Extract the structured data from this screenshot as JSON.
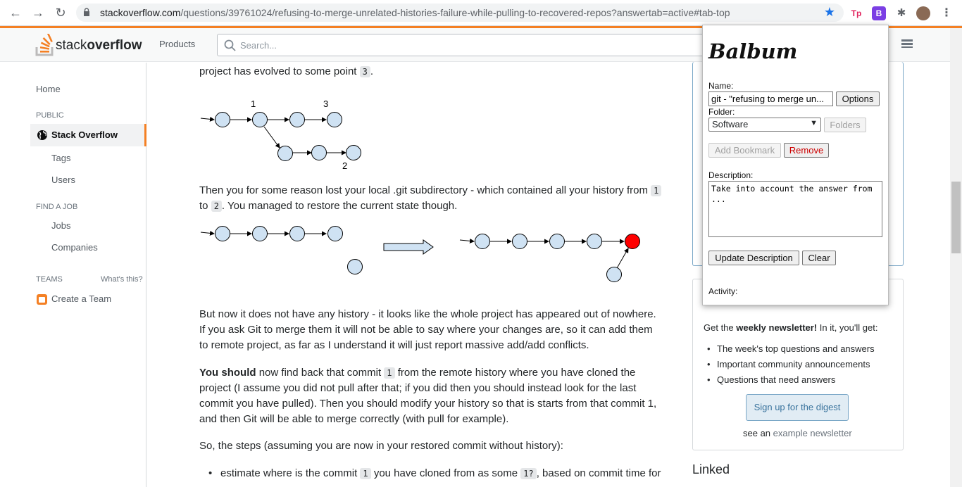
{
  "browser": {
    "url_host": "stackoverflow.com",
    "url_path": "/questions/39761024/refusing-to-merge-unrelated-histories-failure-while-pulling-to-recovered-repos?answertab=active#tab-top",
    "ext_tp": "Tp",
    "ext_b": "B"
  },
  "header": {
    "logo_light": "stack",
    "logo_bold": "overflow",
    "products": "Products",
    "search_placeholder": "Search..."
  },
  "leftnav": {
    "home": "Home",
    "public": "PUBLIC",
    "stackoverflow": "Stack Overflow",
    "tags": "Tags",
    "users": "Users",
    "find_job": "FIND A JOB",
    "jobs": "Jobs",
    "companies": "Companies",
    "teams": "TEAMS",
    "whats_this": "What's this?",
    "create_team": "Create a Team"
  },
  "content": {
    "p0_text": "project has evolved to some point",
    "p0_code": "3",
    "p1_a": "Then you for some reason lost your local .git subdirectory - which contained all your history from",
    "p1_code1": "1",
    "p1_b": "to",
    "p1_code2": "2",
    "p1_c": ". You managed to restore the current state though.",
    "p2": "But now it does not have any history - it looks like the whole project has appeared out of nowhere. If you ask Git to merge them it will not be able to say where your changes are, so it can add them to remote project, as far as I understand it will just report massive add/add conflicts.",
    "p3_bold": "You should",
    "p3_a": " now find back that commit ",
    "p3_code": "1",
    "p3_b": " from the remote history where you have cloned the project (I assume you did not pull after that; if you did then you should instead look for the last commit you have pulled). Then you should modify your history so that is starts from that commit 1, and then Git will be able to merge correctly (with pull for example).",
    "p4": "So, the steps (assuming you are now in your restored commit without history):",
    "li1_a": "estimate where is the commit",
    "li1_code1": "1",
    "li1_b": "you have cloned from as some",
    "li1_code2": "1?",
    "li1_c": ", based on commit time for"
  },
  "diagram": {
    "label_1": "1",
    "label_3": "3",
    "label_2": "2",
    "node_color": "#cfe2f3",
    "head_color": "#ff0000"
  },
  "sidebar": {
    "newsletter_a": "Get the ",
    "newsletter_bold": "weekly newsletter!",
    "newsletter_b": " In it, you'll get:",
    "items": [
      "The week's top questions and answers",
      "Important community announcements",
      "Questions that need answers"
    ],
    "digest_button": "Sign up for the digest",
    "see_an": "see an ",
    "example_newsletter": "example newsletter",
    "linked": "Linked"
  },
  "popup": {
    "title": "Balbum",
    "name_label": "Name:",
    "name_value": "git - \"refusing to merge un...",
    "options": "Options",
    "folder_label": "Folder:",
    "folder_value": "Software",
    "folders": "Folders",
    "add_bookmark": "Add Bookmark",
    "remove": "Remove",
    "description_label": "Description:",
    "description_value": "Take into account the answer from ...",
    "update_description": "Update Description",
    "clear": "Clear",
    "activity": "Activity:"
  }
}
